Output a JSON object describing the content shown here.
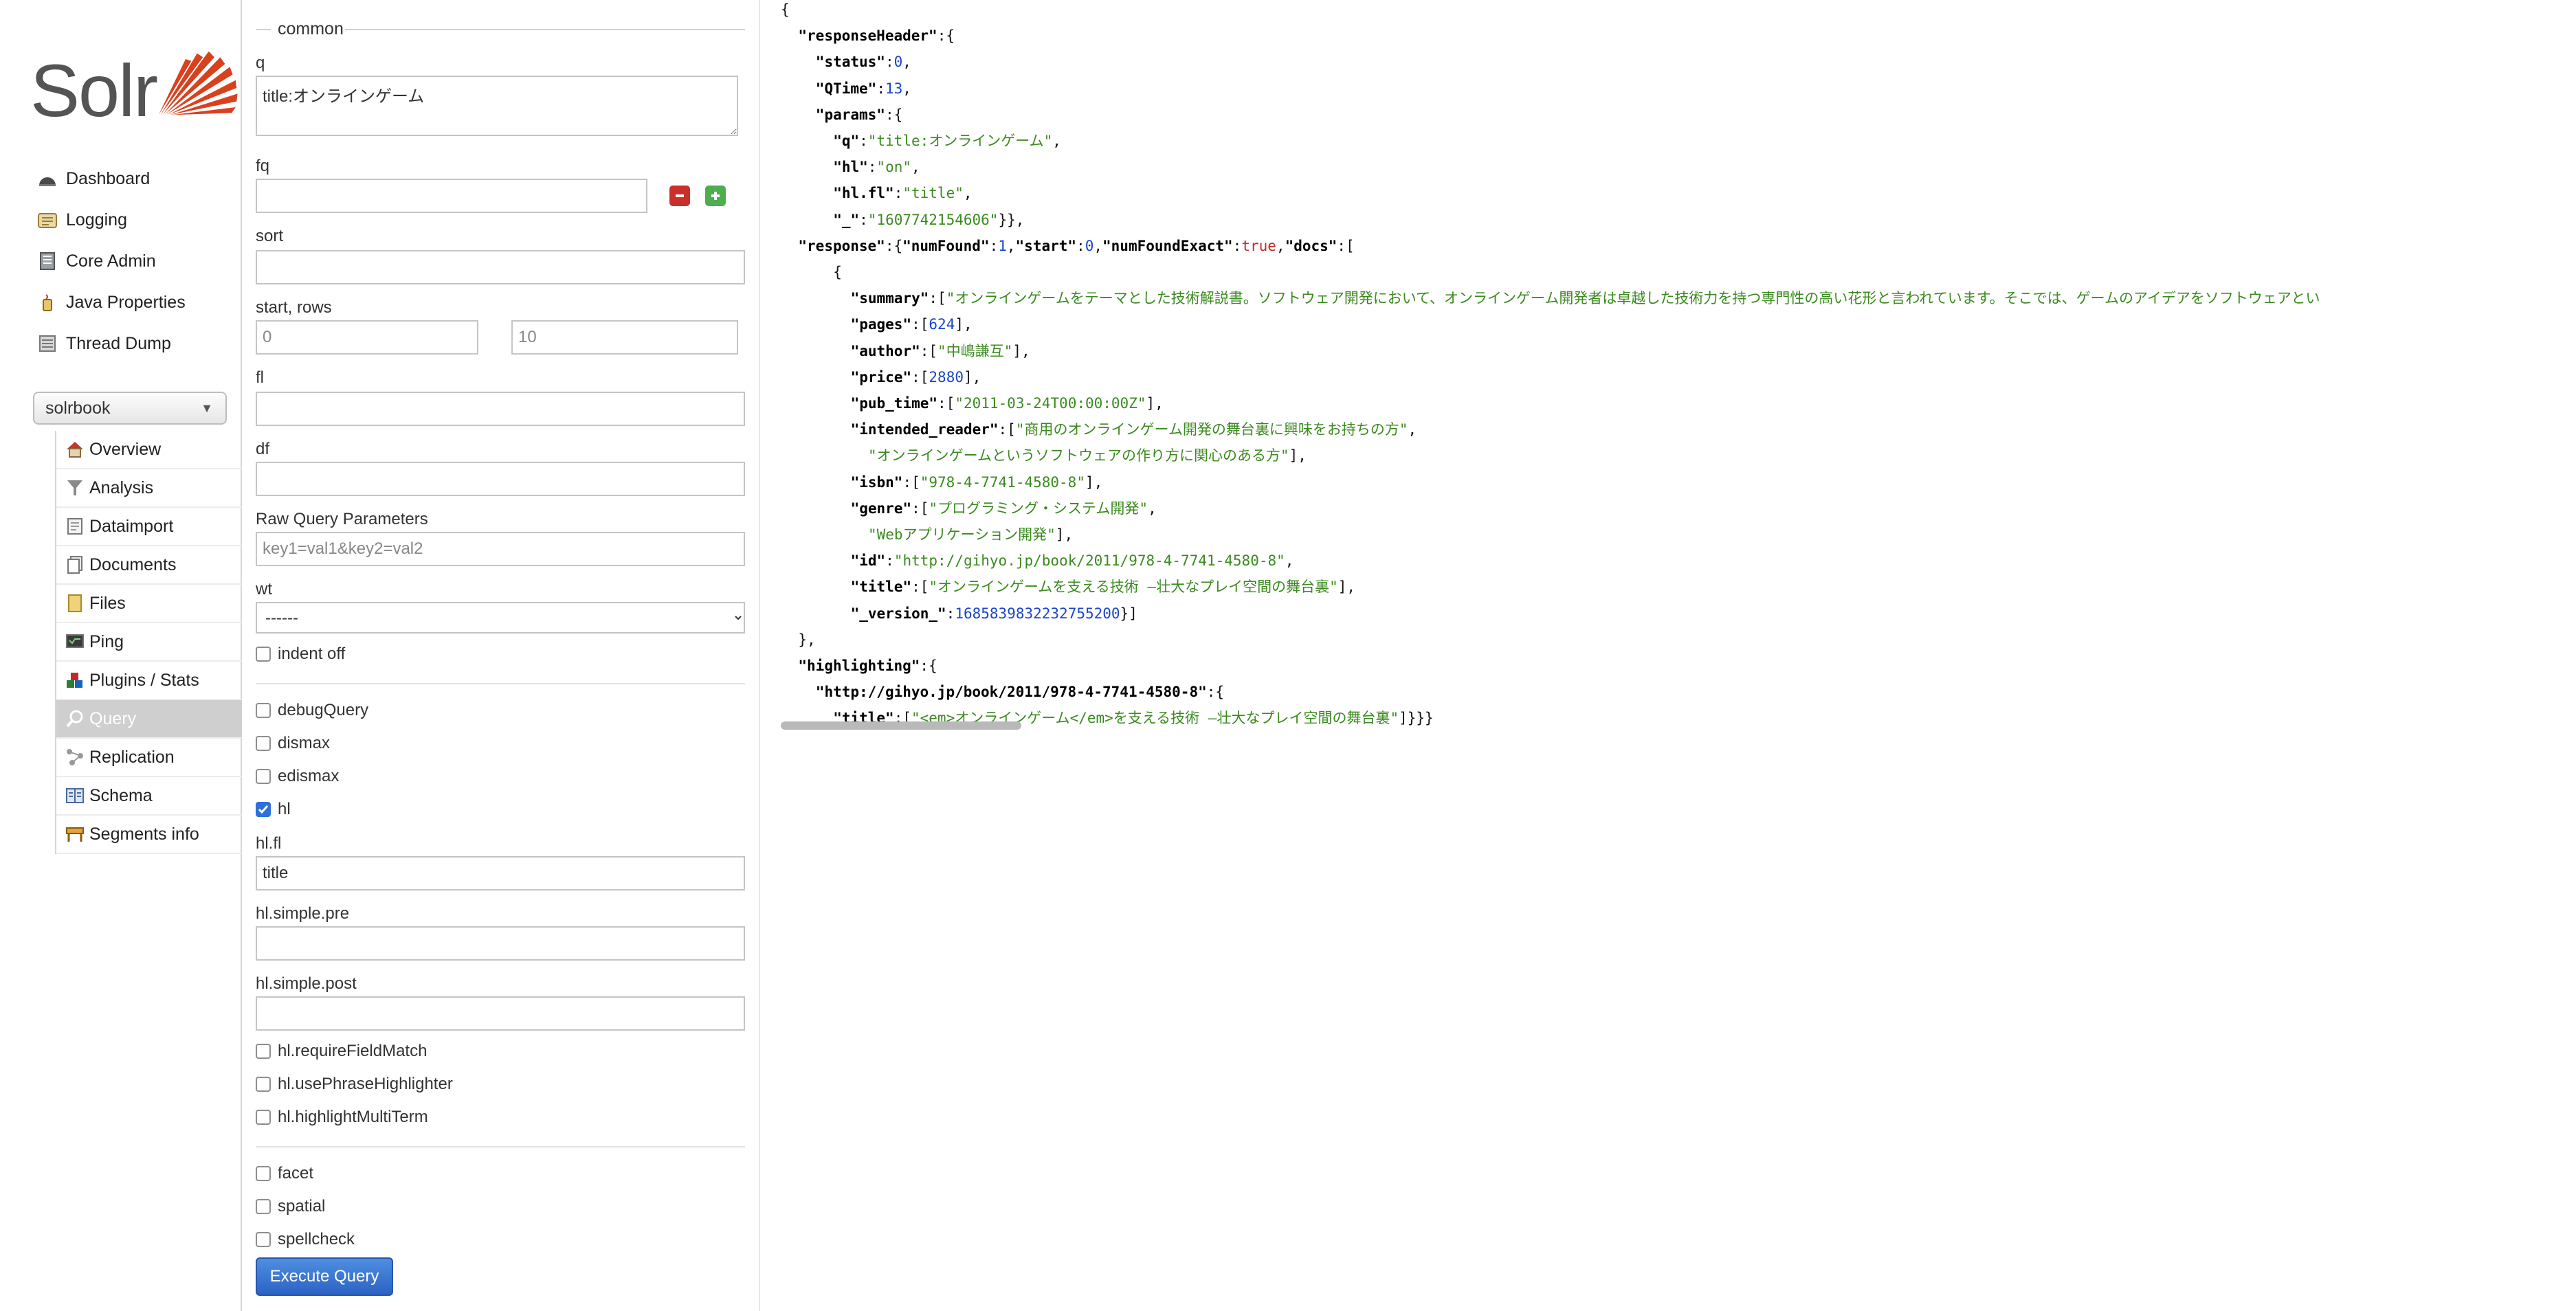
{
  "app": {
    "logo_text": "Solr",
    "brand_color": "#d9411e"
  },
  "nav": [
    {
      "label": "Dashboard",
      "icon": "dashboard-icon"
    },
    {
      "label": "Logging",
      "icon": "logging-icon"
    },
    {
      "label": "Core Admin",
      "icon": "core-admin-icon"
    },
    {
      "label": "Java Properties",
      "icon": "java-properties-icon"
    },
    {
      "label": "Thread Dump",
      "icon": "thread-dump-icon"
    }
  ],
  "core_selector": {
    "value": "solrbook"
  },
  "core_menu": [
    {
      "label": "Overview",
      "icon": "overview-icon"
    },
    {
      "label": "Analysis",
      "icon": "analysis-icon"
    },
    {
      "label": "Dataimport",
      "icon": "dataimport-icon"
    },
    {
      "label": "Documents",
      "icon": "documents-icon"
    },
    {
      "label": "Files",
      "icon": "files-icon"
    },
    {
      "label": "Ping",
      "icon": "ping-icon"
    },
    {
      "label": "Plugins / Stats",
      "icon": "plugins-icon"
    },
    {
      "label": "Query",
      "icon": "query-icon",
      "active": true
    },
    {
      "label": "Replication",
      "icon": "replication-icon"
    },
    {
      "label": "Schema",
      "icon": "schema-icon"
    },
    {
      "label": "Segments info",
      "icon": "segments-icon"
    }
  ],
  "form": {
    "legend": "common",
    "q": {
      "label": "q",
      "value": "title:オンラインゲーム"
    },
    "fq": {
      "label": "fq",
      "value": ""
    },
    "sort": {
      "label": "sort",
      "value": ""
    },
    "start_rows": {
      "label": "start, rows",
      "start_placeholder": "0",
      "rows_placeholder": "10"
    },
    "fl": {
      "label": "fl",
      "value": ""
    },
    "df": {
      "label": "df",
      "value": ""
    },
    "raw": {
      "label": "Raw Query Parameters",
      "placeholder": "key1=val1&key2=val2"
    },
    "wt": {
      "label": "wt",
      "selected": "------"
    },
    "indent_off": {
      "label": "indent off",
      "checked": false
    },
    "debugQuery": {
      "label": "debugQuery",
      "checked": false
    },
    "dismax": {
      "label": "dismax",
      "checked": false
    },
    "edismax": {
      "label": "edismax",
      "checked": false
    },
    "hl": {
      "label": "hl",
      "checked": true
    },
    "hl_fl": {
      "label": "hl.fl",
      "value": "title"
    },
    "hl_simple_pre": {
      "label": "hl.simple.pre",
      "value": ""
    },
    "hl_simple_post": {
      "label": "hl.simple.post",
      "value": ""
    },
    "hl_requireFieldMatch": {
      "label": "hl.requireFieldMatch",
      "checked": false
    },
    "hl_usePhraseHighlighter": {
      "label": "hl.usePhraseHighlighter",
      "checked": false
    },
    "hl_highlightMultiTerm": {
      "label": "hl.highlightMultiTerm",
      "checked": false
    },
    "facet": {
      "label": "facet",
      "checked": false
    },
    "spatial": {
      "label": "spatial",
      "checked": false
    },
    "spellcheck": {
      "label": "spellcheck",
      "checked": false
    },
    "execute_label": "Execute Query"
  },
  "result_lines": [
    {
      "indent": 0,
      "parts": [
        [
          "p",
          "{"
        ]
      ]
    },
    {
      "indent": 2,
      "parts": [
        [
          "k",
          "\"responseHeader\""
        ],
        [
          "p",
          ":{"
        ]
      ]
    },
    {
      "indent": 4,
      "parts": [
        [
          "k",
          "\"status\""
        ],
        [
          "p",
          ":"
        ],
        [
          "n",
          "0"
        ],
        [
          "p",
          ","
        ]
      ]
    },
    {
      "indent": 4,
      "parts": [
        [
          "k",
          "\"QTime\""
        ],
        [
          "p",
          ":"
        ],
        [
          "n",
          "13"
        ],
        [
          "p",
          ","
        ]
      ]
    },
    {
      "indent": 4,
      "parts": [
        [
          "k",
          "\"params\""
        ],
        [
          "p",
          ":{"
        ]
      ]
    },
    {
      "indent": 6,
      "parts": [
        [
          "k",
          "\"q\""
        ],
        [
          "p",
          ":"
        ],
        [
          "s",
          "\"title:オンラインゲーム\""
        ],
        [
          "p",
          ","
        ]
      ]
    },
    {
      "indent": 6,
      "parts": [
        [
          "k",
          "\"hl\""
        ],
        [
          "p",
          ":"
        ],
        [
          "s",
          "\"on\""
        ],
        [
          "p",
          ","
        ]
      ]
    },
    {
      "indent": 6,
      "parts": [
        [
          "k",
          "\"hl.fl\""
        ],
        [
          "p",
          ":"
        ],
        [
          "s",
          "\"title\""
        ],
        [
          "p",
          ","
        ]
      ]
    },
    {
      "indent": 6,
      "parts": [
        [
          "k",
          "\"_\""
        ],
        [
          "p",
          ":"
        ],
        [
          "s",
          "\"1607742154606\""
        ],
        [
          "p",
          "}},"
        ]
      ]
    },
    {
      "indent": 2,
      "parts": [
        [
          "k",
          "\"response\""
        ],
        [
          "p",
          ":{"
        ],
        [
          "k",
          "\"numFound\""
        ],
        [
          "p",
          ":"
        ],
        [
          "n",
          "1"
        ],
        [
          "p",
          ","
        ],
        [
          "k",
          "\"start\""
        ],
        [
          "p",
          ":"
        ],
        [
          "n",
          "0"
        ],
        [
          "p",
          ","
        ],
        [
          "k",
          "\"numFoundExact\""
        ],
        [
          "p",
          ":"
        ],
        [
          "b",
          "true"
        ],
        [
          "p",
          ","
        ],
        [
          "k",
          "\"docs\""
        ],
        [
          "p",
          ":["
        ]
      ]
    },
    {
      "indent": 6,
      "parts": [
        [
          "p",
          "{"
        ]
      ]
    },
    {
      "indent": 8,
      "parts": [
        [
          "k",
          "\"summary\""
        ],
        [
          "p",
          ":["
        ],
        [
          "s",
          "\"オンラインゲームをテーマとした技術解説書。ソフトウェア開発において、オンラインゲーム開発者は卓越した技術力を持つ専門性の高い花形と言われています。そこでは、ゲームのアイデアをソフトウェアとい"
        ]
      ]
    },
    {
      "indent": 8,
      "parts": [
        [
          "k",
          "\"pages\""
        ],
        [
          "p",
          ":["
        ],
        [
          "n",
          "624"
        ],
        [
          "p",
          "],"
        ]
      ]
    },
    {
      "indent": 8,
      "parts": [
        [
          "k",
          "\"author\""
        ],
        [
          "p",
          ":["
        ],
        [
          "s",
          "\"中嶋謙互\""
        ],
        [
          "p",
          "],"
        ]
      ]
    },
    {
      "indent": 8,
      "parts": [
        [
          "k",
          "\"price\""
        ],
        [
          "p",
          ":["
        ],
        [
          "n",
          "2880"
        ],
        [
          "p",
          "],"
        ]
      ]
    },
    {
      "indent": 8,
      "parts": [
        [
          "k",
          "\"pub_time\""
        ],
        [
          "p",
          ":["
        ],
        [
          "s",
          "\"2011-03-24T00:00:00Z\""
        ],
        [
          "p",
          "],"
        ]
      ]
    },
    {
      "indent": 8,
      "parts": [
        [
          "k",
          "\"intended_reader\""
        ],
        [
          "p",
          ":["
        ],
        [
          "s",
          "\"商用のオンラインゲーム開発の舞台裏に興味をお持ちの方\""
        ],
        [
          "p",
          ","
        ]
      ]
    },
    {
      "indent": 10,
      "parts": [
        [
          "s",
          "\"オンラインゲームというソフトウェアの作り方に関心のある方\""
        ],
        [
          "p",
          "],"
        ]
      ]
    },
    {
      "indent": 8,
      "parts": [
        [
          "k",
          "\"isbn\""
        ],
        [
          "p",
          ":["
        ],
        [
          "s",
          "\"978-4-7741-4580-8\""
        ],
        [
          "p",
          "],"
        ]
      ]
    },
    {
      "indent": 8,
      "parts": [
        [
          "k",
          "\"genre\""
        ],
        [
          "p",
          ":["
        ],
        [
          "s",
          "\"プログラミング・システム開発\""
        ],
        [
          "p",
          ","
        ]
      ]
    },
    {
      "indent": 10,
      "parts": [
        [
          "s",
          "\"Webアプリケーション開発\""
        ],
        [
          "p",
          "],"
        ]
      ]
    },
    {
      "indent": 8,
      "parts": [
        [
          "k",
          "\"id\""
        ],
        [
          "p",
          ":"
        ],
        [
          "s",
          "\"http://gihyo.jp/book/2011/978-4-7741-4580-8\""
        ],
        [
          "p",
          ","
        ]
      ]
    },
    {
      "indent": 8,
      "parts": [
        [
          "k",
          "\"title\""
        ],
        [
          "p",
          ":["
        ],
        [
          "s",
          "\"オンラインゲームを支える技術 —壮大なプレイ空間の舞台裏\""
        ],
        [
          "p",
          "],"
        ]
      ]
    },
    {
      "indent": 8,
      "parts": [
        [
          "k",
          "\"_version_\""
        ],
        [
          "p",
          ":"
        ],
        [
          "n",
          "1685839832232755200"
        ],
        [
          "p",
          "}]"
        ]
      ]
    },
    {
      "indent": 2,
      "parts": [
        [
          "p",
          "},"
        ]
      ]
    },
    {
      "indent": 2,
      "parts": [
        [
          "k",
          "\"highlighting\""
        ],
        [
          "p",
          ":{"
        ]
      ]
    },
    {
      "indent": 4,
      "parts": [
        [
          "k",
          "\"http://gihyo.jp/book/2011/978-4-7741-4580-8\""
        ],
        [
          "p",
          ":{"
        ]
      ]
    },
    {
      "indent": 6,
      "parts": [
        [
          "k",
          "\"title\""
        ],
        [
          "p",
          ":["
        ],
        [
          "s",
          "\"<em>オンラインゲーム</em>を支える技術 —壮大なプレイ空間の舞台裏\""
        ],
        [
          "p",
          "]}}}"
        ]
      ]
    }
  ]
}
